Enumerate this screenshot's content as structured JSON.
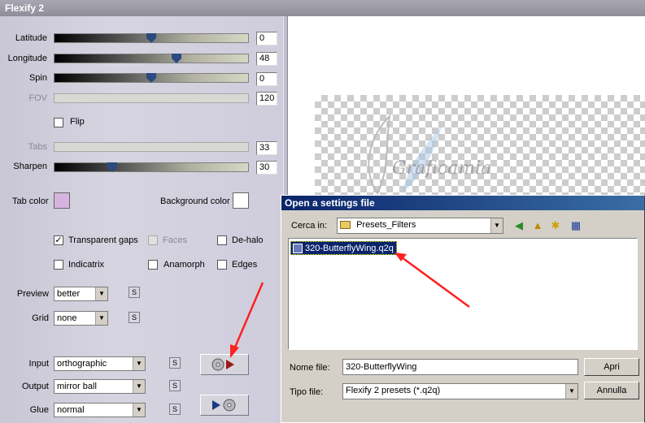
{
  "window": {
    "title": "Flexify 2"
  },
  "sliders": [
    {
      "label": "Latitude",
      "value": "0",
      "level": 0.5,
      "enabled": true
    },
    {
      "label": "Longitude",
      "value": "48",
      "level": 0.63,
      "enabled": true
    },
    {
      "label": "Spin",
      "value": "0",
      "level": 0.5,
      "enabled": true
    },
    {
      "label": "FOV",
      "value": "120",
      "enabled": false
    },
    {
      "label": "Tabs",
      "value": "33",
      "enabled": false
    },
    {
      "label": "Sharpen",
      "value": "30",
      "level": 0.3,
      "enabled": true
    }
  ],
  "flip": {
    "label": "Flip",
    "checked": false
  },
  "colors": {
    "tab_label": "Tab color",
    "tab_color": "#d7b4e0",
    "background_label": "Background color",
    "background_color": "#ffffff"
  },
  "options": {
    "transparent_gaps": {
      "label": "Transparent gaps",
      "checked": true
    },
    "faces": {
      "label": "Faces",
      "checked": false
    },
    "de_halo": {
      "label": "De-halo",
      "checked": false
    },
    "indicatrix": {
      "label": "Indicatrix",
      "checked": false
    },
    "anamorph": {
      "label": "Anamorph",
      "checked": false
    },
    "edges": {
      "label": "Edges",
      "checked": false
    }
  },
  "preview": {
    "label": "Preview",
    "value": "better"
  },
  "grid": {
    "label": "Grid",
    "value": "none"
  },
  "input": {
    "label": "Input",
    "value": "orthographic"
  },
  "output": {
    "label": "Output",
    "value": "mirror ball"
  },
  "glue": {
    "label": "Glue",
    "value": "normal"
  },
  "small_button_label": "S",
  "watermark_text": "Graficamia",
  "dialog": {
    "title": "Open a settings file",
    "look_in_label": "Cerca in:",
    "look_in_value": "Presets_Filters",
    "selected_file": "320-ButterflyWing.q2q",
    "filename_label": "Nome file:",
    "filename_value": "320-ButterflyWing",
    "filetype_label": "Tipo file:",
    "filetype_value": "Flexify 2 presets (*.q2q)",
    "open_button": "Apri",
    "cancel_button": "Annulla"
  },
  "accent_colors": {
    "arrow": "#ff2020",
    "dialog_title": "#0a246a"
  }
}
